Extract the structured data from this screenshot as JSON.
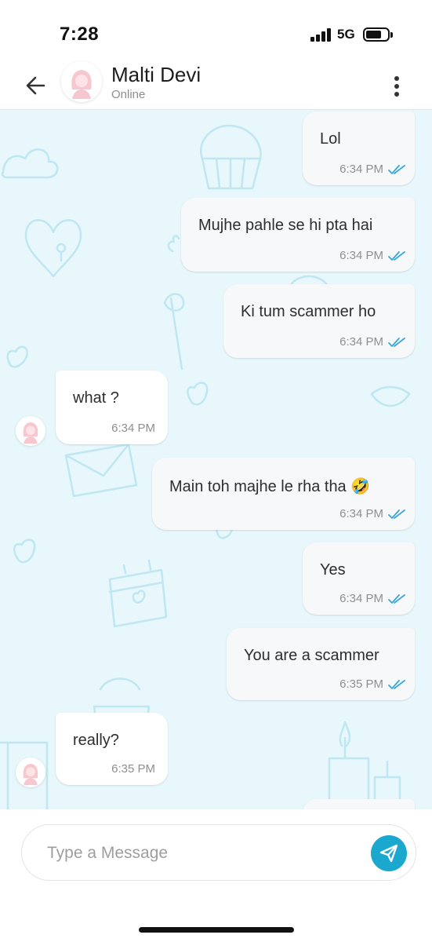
{
  "status_bar": {
    "time": "7:28",
    "network": "5G"
  },
  "header": {
    "contact_name": "Malti Devi",
    "contact_status": "Online",
    "back_icon": "arrow-left-icon",
    "menu_icon": "more-vertical-icon"
  },
  "messages": [
    {
      "direction": "out",
      "text": "Lol",
      "time": "6:34 PM",
      "read": true
    },
    {
      "direction": "out",
      "text": "Mujhe pahle se hi pta hai",
      "time": "6:34 PM",
      "read": true
    },
    {
      "direction": "out",
      "text": "Ki tum scammer ho",
      "time": "6:34 PM",
      "read": true
    },
    {
      "direction": "in",
      "text": "what ?",
      "time": "6:34 PM"
    },
    {
      "direction": "out",
      "text": "Main toh majhe le rha tha 🤣",
      "time": "6:34 PM",
      "read": true
    },
    {
      "direction": "out",
      "text": "Yes",
      "time": "6:34 PM",
      "read": true
    },
    {
      "direction": "out",
      "text": "You are a scammer",
      "time": "6:35 PM",
      "read": true
    },
    {
      "direction": "in",
      "text": "really?",
      "time": "6:35 PM"
    }
  ],
  "composer": {
    "placeholder": "Type a Message",
    "send_icon": "send-icon"
  },
  "colors": {
    "chat_background": "#e7f7fb",
    "accent": "#1aa8cf",
    "read_tick": "#3aa7d6"
  }
}
